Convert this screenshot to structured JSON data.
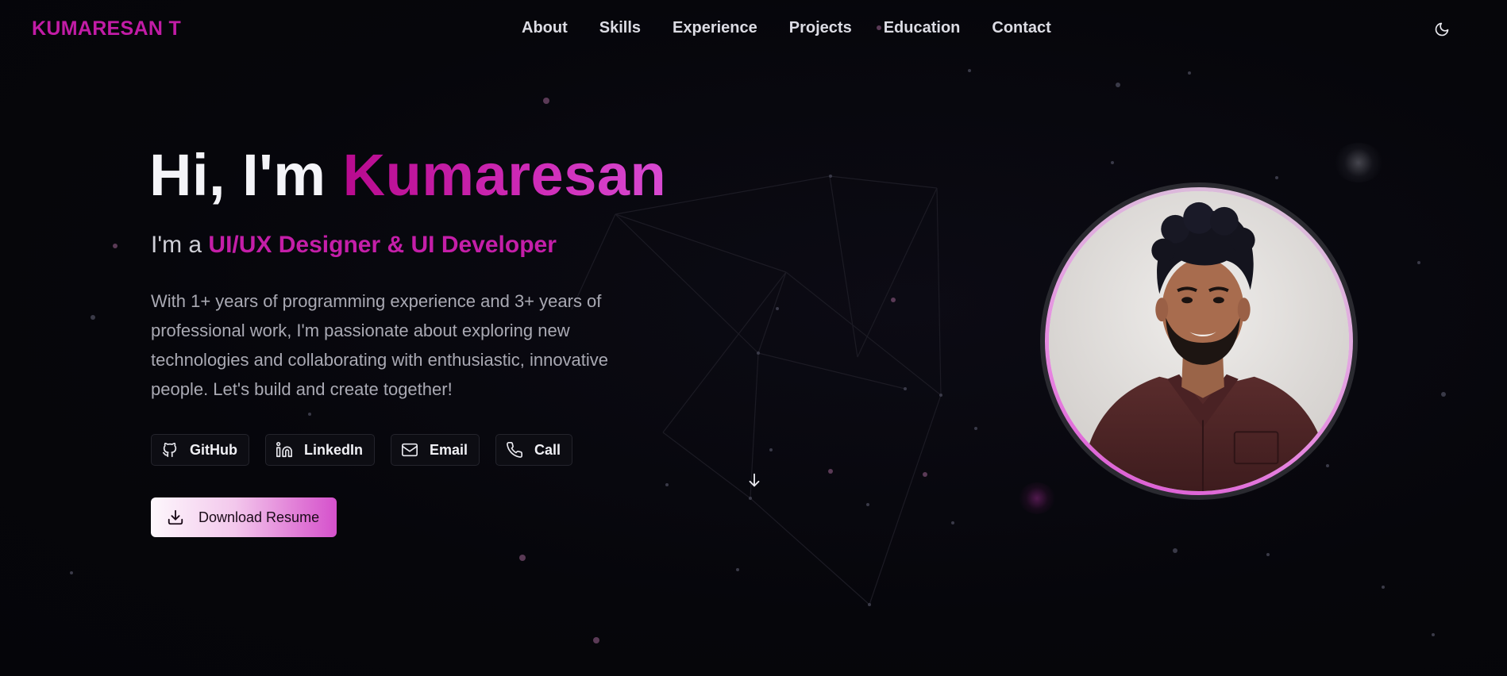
{
  "brand": {
    "name": "KUMARESAN T",
    "color": "#c21ca6"
  },
  "nav": {
    "links": [
      {
        "label": "About"
      },
      {
        "label": "Skills"
      },
      {
        "label": "Experience"
      },
      {
        "label": "Projects"
      },
      {
        "label": "Education"
      },
      {
        "label": "Contact"
      }
    ],
    "theme_toggle_icon": "moon-icon"
  },
  "hero": {
    "greeting": "Hi, I'm ",
    "name": "Kumaresan",
    "subtitle_prefix": "I'm a ",
    "role": "UI/UX Designer & UI Developer",
    "description": "With 1+ years of programming experience and 3+ years of professional work, I'm passionate about exploring new technologies and collaborating with enthusiastic, innovative people. Let's build and create together!",
    "socials": [
      {
        "label": "GitHub",
        "icon": "github-icon"
      },
      {
        "label": "LinkedIn",
        "icon": "linkedin-icon"
      },
      {
        "label": "Email",
        "icon": "mail-icon"
      },
      {
        "label": "Call",
        "icon": "phone-icon"
      }
    ],
    "resume_button": {
      "label": "Download Resume",
      "icon": "download-icon"
    },
    "scroll_icon": "arrow-down-icon"
  },
  "colors": {
    "accent": "#c21ca6",
    "background": "#06060b",
    "text": "#f4f4f8",
    "muted": "#a9a9b3"
  }
}
